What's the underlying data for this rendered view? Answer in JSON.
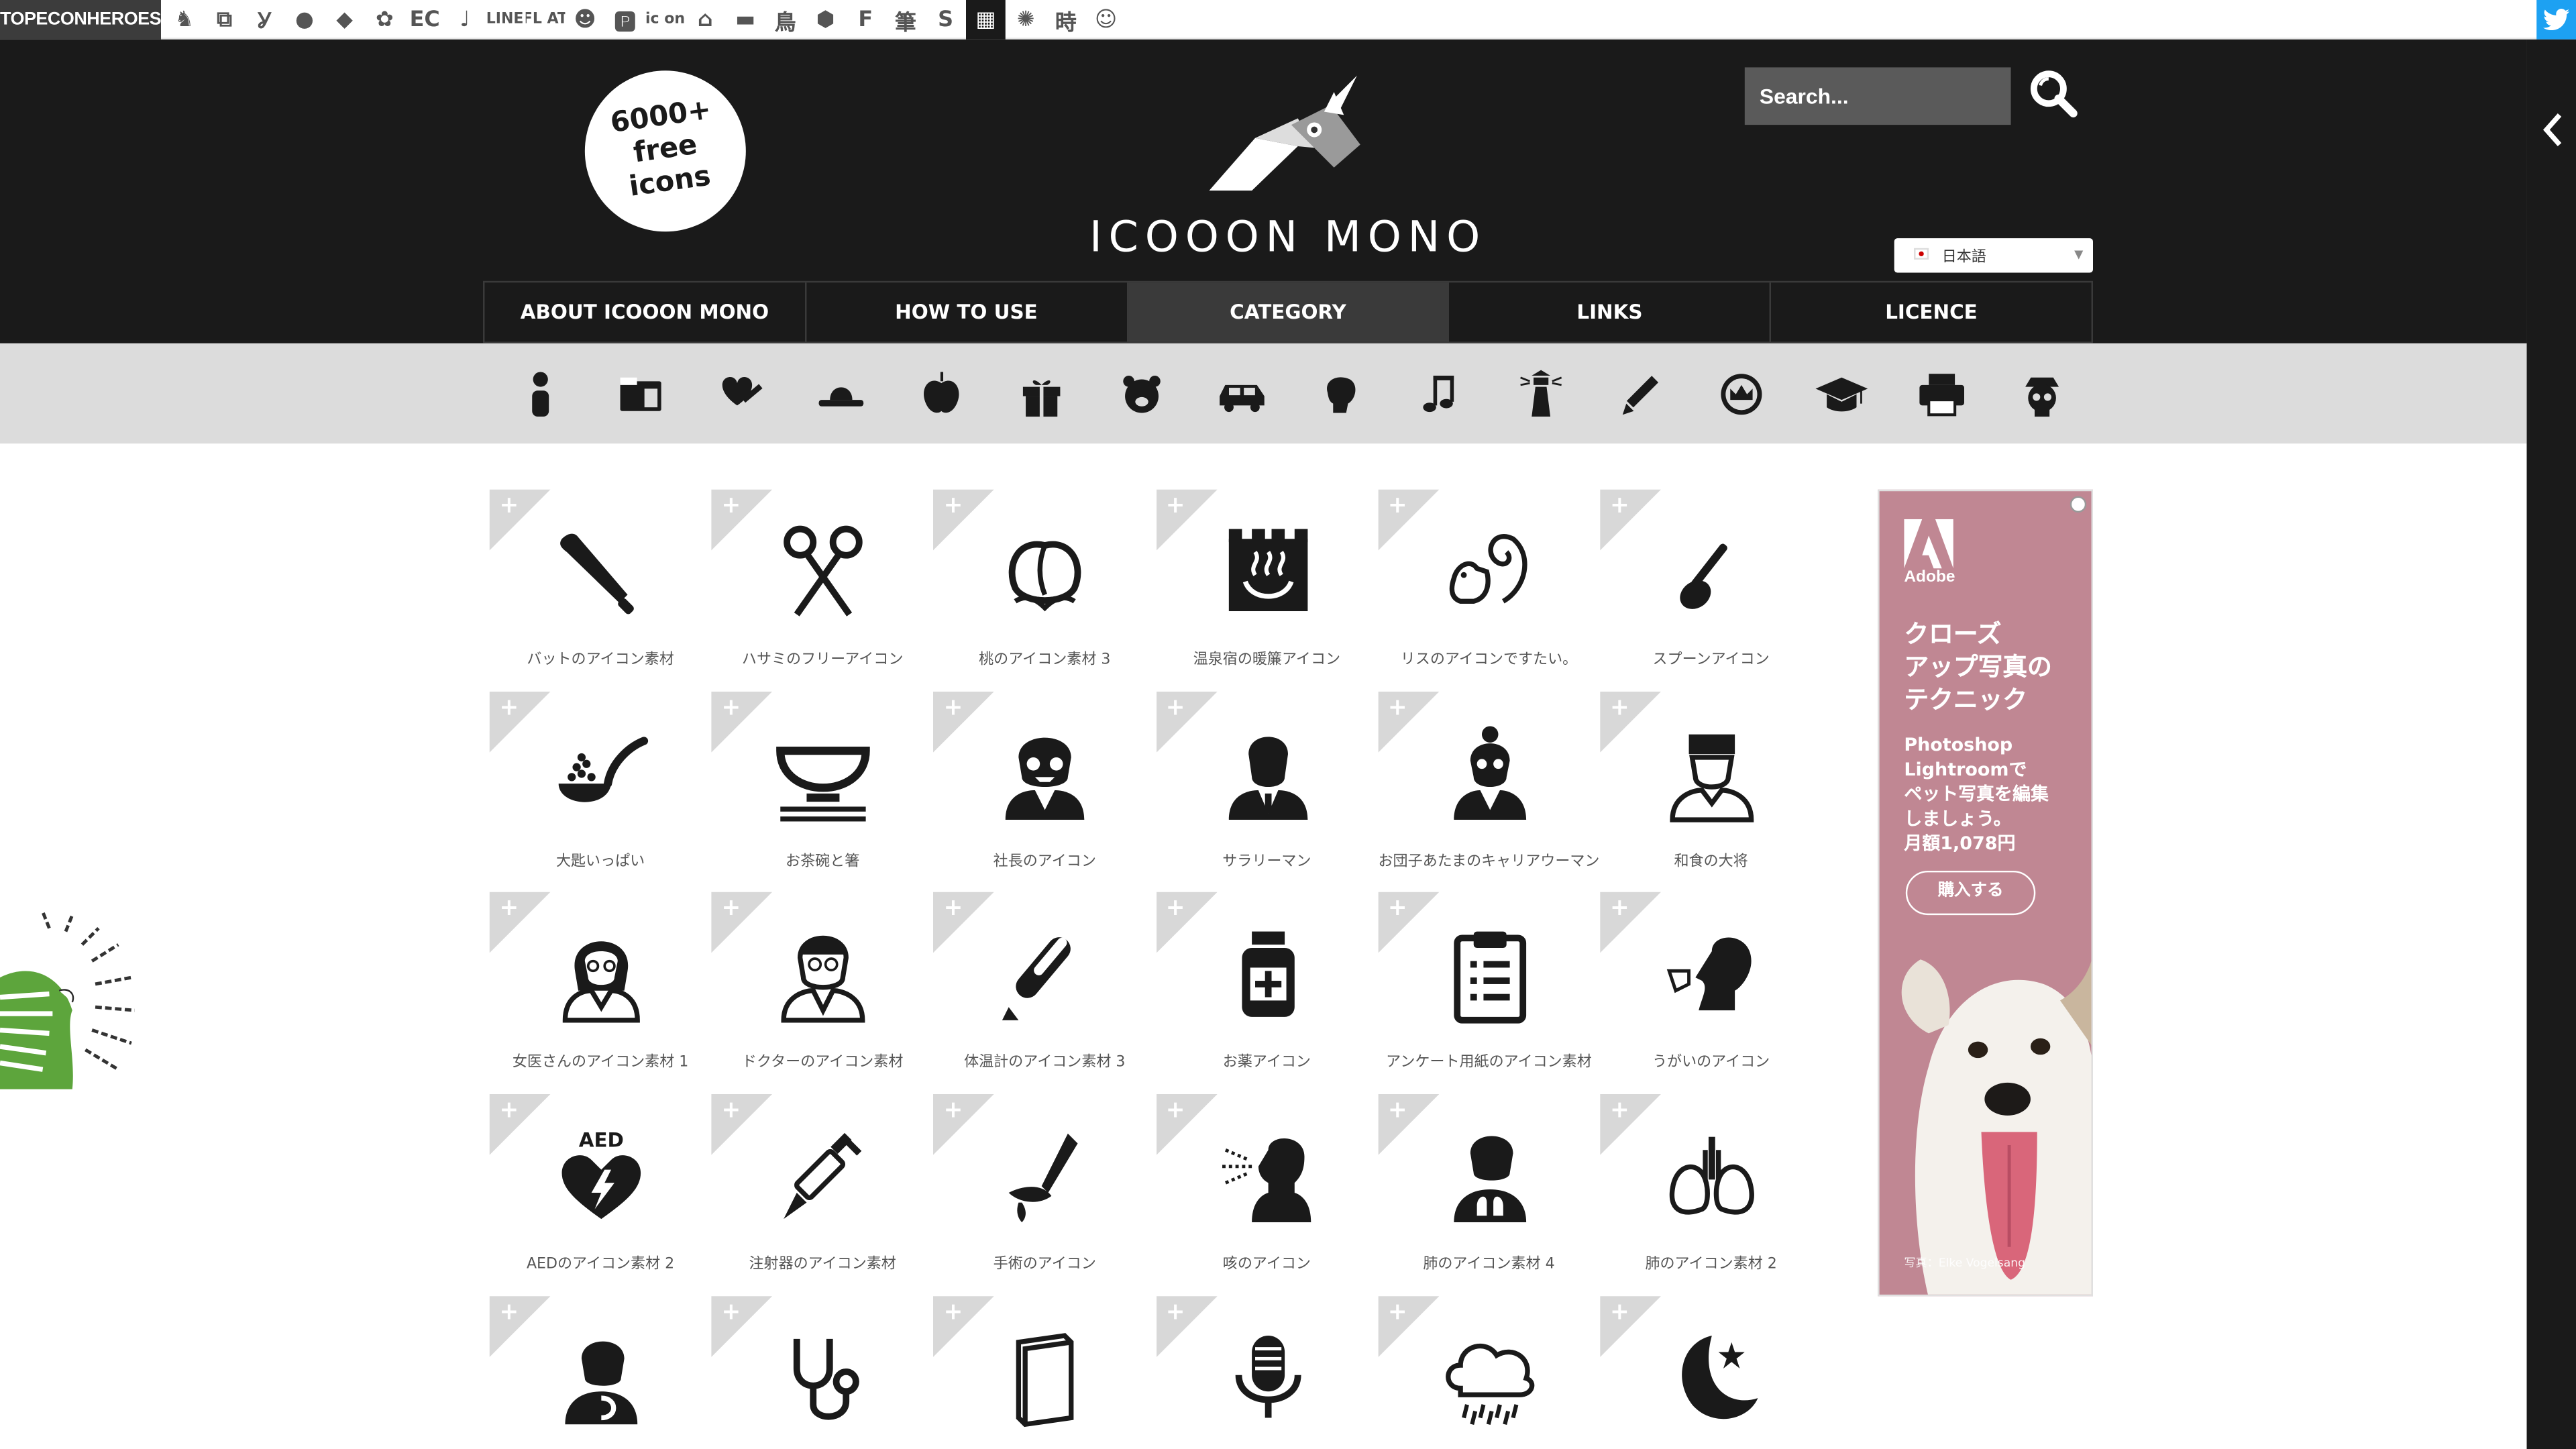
{
  "topbar": {
    "brand": "TOPECONHEROES",
    "sites": [
      {
        "icon": "elephant-icon",
        "glyph": "♞"
      },
      {
        "icon": "copy-icon",
        "glyph": "⧉"
      },
      {
        "icon": "person-icon",
        "glyph": "Ỿ"
      },
      {
        "icon": "chat-icon",
        "glyph": "●"
      },
      {
        "icon": "bird-icon",
        "glyph": "◆"
      },
      {
        "icon": "flower-icon",
        "glyph": "✿"
      },
      {
        "icon": "ec-text",
        "glyph": "EC"
      },
      {
        "icon": "music-note-icon",
        "glyph": "♩"
      },
      {
        "icon": "line-text",
        "glyph": "LINE",
        "small": true
      },
      {
        "icon": "flat-text",
        "glyph": "FL AT",
        "small": true
      },
      {
        "icon": "smile-icon",
        "glyph": "☻"
      },
      {
        "icon": "parking-icon",
        "glyph": "🅿"
      },
      {
        "icon": "icon-text",
        "glyph": "ic on",
        "small": true
      },
      {
        "icon": "house-icon",
        "glyph": "⌂"
      },
      {
        "icon": "car-icon",
        "glyph": "▬"
      },
      {
        "icon": "bird2-icon",
        "glyph": "鳥"
      },
      {
        "icon": "hexagon-icon",
        "glyph": "⬢"
      },
      {
        "icon": "f-text",
        "glyph": "F"
      },
      {
        "icon": "brush-kanji-icon",
        "glyph": "筆"
      },
      {
        "icon": "s-text",
        "glyph": "S"
      },
      {
        "icon": "grid-icon",
        "glyph": "▦",
        "active": true
      },
      {
        "icon": "burst-icon",
        "glyph": "✺"
      },
      {
        "icon": "time-kanji-icon",
        "glyph": "時"
      },
      {
        "icon": "face-icon",
        "glyph": "☺"
      }
    ]
  },
  "header": {
    "badge": "6000+\nfree\nicons",
    "title": "ICOOON MONO",
    "search_placeholder": "Search...",
    "language": "日本語"
  },
  "nav": [
    {
      "label": "ABOUT ICOOON MONO"
    },
    {
      "label": "HOW TO USE"
    },
    {
      "label": "CATEGORY",
      "active": true
    },
    {
      "label": "LINKS"
    },
    {
      "label": "LICENCE"
    }
  ],
  "categories": [
    "person-icon",
    "folder-icon",
    "heart-syringe-icon",
    "hat-icon",
    "apple-icon",
    "gift-icon",
    "bear-icon",
    "car-icon",
    "boxing-glove-icon",
    "music-note-icon",
    "lighthouse-icon",
    "pencil-icon",
    "crown-icon",
    "graduation-cap-icon",
    "printer-icon",
    "skull-pirate-icon"
  ],
  "icons": [
    {
      "icon": "baseball-bat-icon",
      "label": "バットのアイコン素材"
    },
    {
      "icon": "scissors-icon",
      "label": "ハサミのフリーアイコン"
    },
    {
      "icon": "peach-icon",
      "label": "桃のアイコン素材 3"
    },
    {
      "icon": "hot-spring-sign-icon",
      "label": "温泉宿の暖簾アイコン"
    },
    {
      "icon": "squirrel-icon",
      "label": "リスのアイコンですたい。"
    },
    {
      "icon": "spoon-icon",
      "label": "スプーンアイコン"
    },
    {
      "icon": "ladle-icon",
      "label": "大匙いっぱい"
    },
    {
      "icon": "rice-bowl-icon",
      "label": "お茶碗と箸"
    },
    {
      "icon": "president-icon",
      "label": "社長のアイコン"
    },
    {
      "icon": "salaryman-icon",
      "label": "サラリーマン"
    },
    {
      "icon": "career-woman-icon",
      "label": "お団子あたまのキャリアウーマン"
    },
    {
      "icon": "chef-icon",
      "label": "和食の大将"
    },
    {
      "icon": "female-doctor-icon",
      "label": "女医さんのアイコン素材 1"
    },
    {
      "icon": "doctor-icon",
      "label": "ドクターのアイコン素材"
    },
    {
      "icon": "thermometer-icon",
      "label": "体温計のアイコン素材 3"
    },
    {
      "icon": "medicine-bottle-icon",
      "label": "お薬アイコン"
    },
    {
      "icon": "clipboard-icon",
      "label": "アンケート用紙のアイコン素材"
    },
    {
      "icon": "gargle-icon",
      "label": "うがいのアイコン"
    },
    {
      "icon": "aed-icon",
      "label": "AEDのアイコン素材 2"
    },
    {
      "icon": "syringe-icon",
      "label": "注射器のアイコン素材"
    },
    {
      "icon": "scalpel-icon",
      "label": "手術のアイコン"
    },
    {
      "icon": "cough-icon",
      "label": "咳のアイコン"
    },
    {
      "icon": "lungs-person-icon",
      "label": "肺のアイコン素材 4"
    },
    {
      "icon": "lungs-icon",
      "label": "肺のアイコン素材 2"
    },
    {
      "icon": "stomach-person-icon",
      "label": ""
    },
    {
      "icon": "stethoscope-icon",
      "label": ""
    },
    {
      "icon": "book-icon",
      "label": ""
    },
    {
      "icon": "microphone-icon",
      "label": ""
    },
    {
      "icon": "rain-cloud-icon",
      "label": ""
    },
    {
      "icon": "moon-star-icon",
      "label": ""
    }
  ],
  "ad": {
    "brand": "Adobe",
    "headline": "クローズ\nアップ写真の\nテクニック",
    "body": "Photoshop\nLightroomで\nペット写真を編集\nしましょう。\n月額1,078円",
    "cta": "購入する",
    "credit": "写真：Elke Vogelsang"
  },
  "colors": {
    "header_bg": "#1a1a1a",
    "category_bar_bg": "#dcdcdc",
    "ad_bg": "#c08793",
    "twitter": "#1da1f2"
  }
}
